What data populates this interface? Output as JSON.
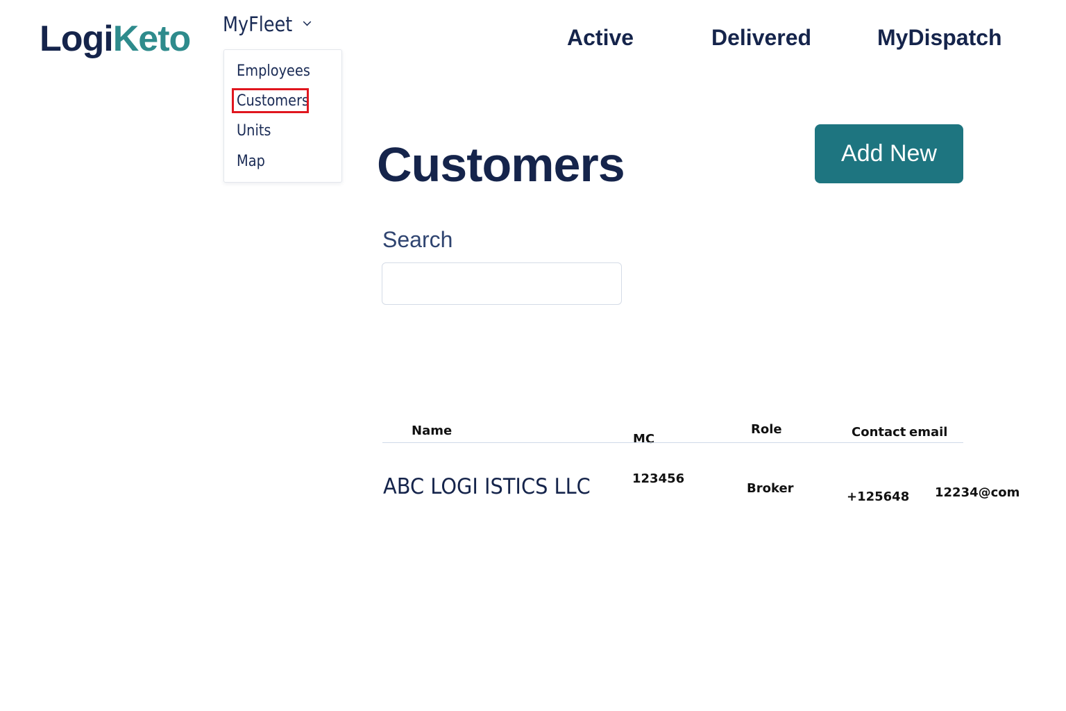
{
  "brand": {
    "logo_part1": "Logi",
    "logo_part2": "Keto",
    "colors": {
      "navy": "#15244b",
      "teal": "#2e8b8c",
      "button": "#1e7580",
      "highlight": "#e0161e"
    }
  },
  "header": {
    "menu": {
      "label": "MyFleet",
      "icon": "chevron-down-icon",
      "items": [
        "Employees",
        "Customers",
        "Units",
        "Map"
      ],
      "highlighted_item": "Customers"
    },
    "nav": {
      "active": "Active",
      "delivered": "Delivered",
      "mydispatch": "MyDispatch"
    }
  },
  "main": {
    "title": "Customers",
    "add_new_label": "Add New",
    "search": {
      "label": "Search",
      "value": "",
      "placeholder": ""
    },
    "table": {
      "columns": [
        "Name",
        "MC",
        "Role",
        "Contact",
        "email"
      ],
      "rows": [
        {
          "name": "ABC LOGI ISTICS LLC",
          "mc": "123456",
          "role": "Broker",
          "contact": "+125648",
          "email": "12234@com"
        }
      ]
    }
  }
}
